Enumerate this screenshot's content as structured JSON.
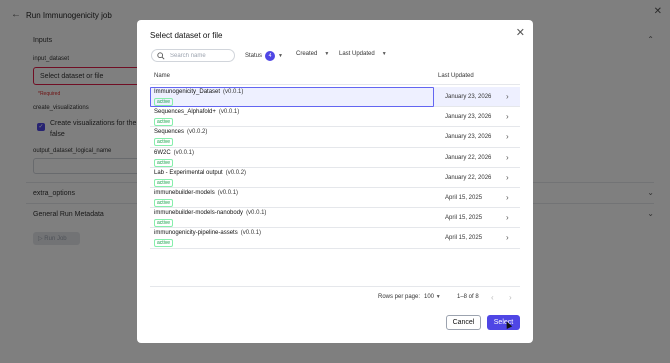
{
  "page": {
    "title": "Run Immunogenicity job",
    "inputs_label": "Inputs",
    "input_dataset_label": "input_dataset",
    "select_placeholder": "Select dataset or file",
    "required_text": "*Required",
    "create_vis_label": "create_visualizations",
    "create_vis_text_1": "Create visualizations for the",
    "create_vis_text_2": "false",
    "output_label": "output_dataset_logical_name",
    "extra_options_label": "extra_options",
    "general_meta_label": "General Run Metadata",
    "run_job_label": "Run Job"
  },
  "modal": {
    "title": "Select dataset or file",
    "search_placeholder": "Search name",
    "filters": {
      "status_label": "Status",
      "status_count": "4",
      "created_label": "Created",
      "last_updated_label": "Last Updated"
    },
    "columns": {
      "name": "Name",
      "last_updated": "Last Updated"
    },
    "rows": [
      {
        "name": "Immunogenicity_Dataset",
        "version": "(v0.0.1)",
        "status": "active",
        "date": "January 23, 2026",
        "selected": true
      },
      {
        "name": "Sequences_Alphafold+",
        "version": "(v0.0.1)",
        "status": "active",
        "date": "January 23, 2026"
      },
      {
        "name": "Sequences",
        "version": "(v0.0.2)",
        "status": "active",
        "date": "January 23, 2026"
      },
      {
        "name": "6W2C",
        "version": "(v0.0.1)",
        "status": "active",
        "date": "January 22, 2026"
      },
      {
        "name": "Lab - Experimental output",
        "version": "(v0.0.2)",
        "status": "active",
        "date": "January 22, 2026"
      },
      {
        "name": "immunebuilder-models",
        "version": "(v0.0.1)",
        "status": "active",
        "date": "April 15, 2025"
      },
      {
        "name": "immunebuilder-models-nanobody",
        "version": "(v0.0.1)",
        "status": "active",
        "date": "April 15, 2025"
      },
      {
        "name": "immunogenicity-pipeline-assets",
        "version": "(v0.0.1)",
        "status": "active",
        "date": "April 15, 2025"
      }
    ],
    "pagination": {
      "rows_per_page_label": "Rows per page:",
      "rows_per_page_value": "100",
      "range": "1–8 of 8"
    },
    "cancel_label": "Cancel",
    "select_label": "Select"
  },
  "colors": {
    "accent": "#4f46e5",
    "active_badge": "#16a34a",
    "required": "#dc2626"
  },
  "icons": {
    "back": "arrow-left-icon",
    "close": "close-icon",
    "search": "search-icon",
    "row_arrow": "chevron-right-icon"
  }
}
